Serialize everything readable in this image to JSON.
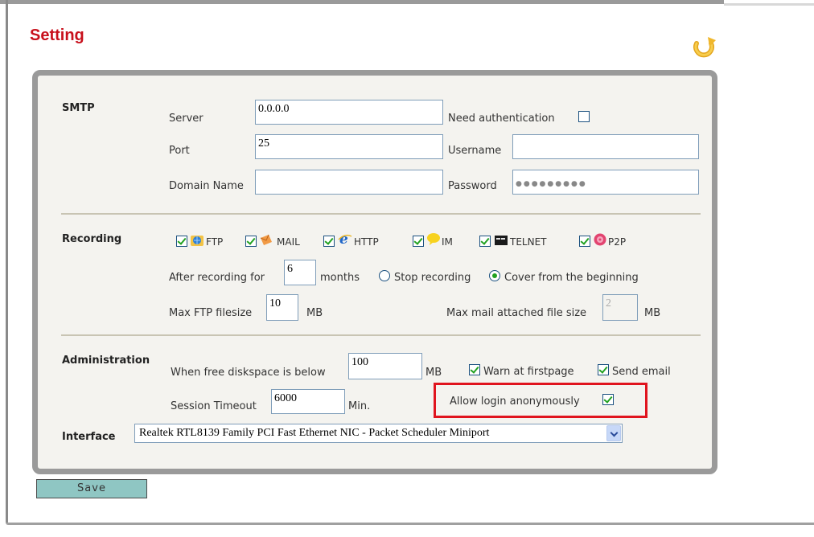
{
  "page": {
    "title": "Setting",
    "refresh_icon": "refresh-icon"
  },
  "smtp": {
    "section_label": "SMTP",
    "server_label": "Server",
    "server_value": "0.0.0.0",
    "port_label": "Port",
    "port_value": "25",
    "domain_label": "Domain Name",
    "domain_value": "",
    "need_auth_label": "Need authentication",
    "need_auth_checked": false,
    "username_label": "Username",
    "username_value": "",
    "password_label": "Password",
    "password_value": "●●●●●●●●●"
  },
  "recording": {
    "section_label": "Recording",
    "protocols": [
      {
        "label": "FTP",
        "checked": true,
        "icon": "ftp-globe-icon"
      },
      {
        "label": "MAIL",
        "checked": true,
        "icon": "mail-envelope-icon"
      },
      {
        "label": "HTTP",
        "checked": true,
        "icon": "ie-browser-icon"
      },
      {
        "label": "IM",
        "checked": true,
        "icon": "im-chat-icon"
      },
      {
        "label": "TELNET",
        "checked": true,
        "icon": "telnet-terminal-icon"
      },
      {
        "label": "P2P",
        "checked": true,
        "icon": "p2p-icon"
      }
    ],
    "after_recording_label": "After recording for",
    "months_value": "6",
    "months_label": "months",
    "stop_recording_label": "Stop recording",
    "stop_recording_selected": false,
    "cover_label": "Cover from the beginning",
    "cover_selected": true,
    "max_ftp_label": "Max FTP filesize",
    "max_ftp_value": "10",
    "max_ftp_unit": "MB",
    "max_mail_label": "Max mail attached file size",
    "max_mail_value": "2",
    "max_mail_unit": "MB"
  },
  "administration": {
    "section_label": "Administration",
    "free_disk_label": "When free diskspace is below",
    "free_disk_value": "100",
    "free_disk_unit": "MB",
    "warn_label": "Warn at firstpage",
    "warn_checked": true,
    "send_email_label": "Send email",
    "send_email_checked": true,
    "session_timeout_label": "Session Timeout",
    "session_timeout_value": "6000",
    "session_timeout_unit": "Min.",
    "allow_anon_label": "Allow login anonymously",
    "allow_anon_checked": true
  },
  "interface": {
    "label": "Interface",
    "selected": "Realtek RTL8139 Family PCI Fast Ethernet NIC - Packet Scheduler Miniport"
  },
  "actions": {
    "save_label": "Save"
  },
  "colors": {
    "title": "#c8101c",
    "highlight": "#e0141e",
    "save_button": "#8fc6c3",
    "panel_bg": "#f4f3ef"
  }
}
